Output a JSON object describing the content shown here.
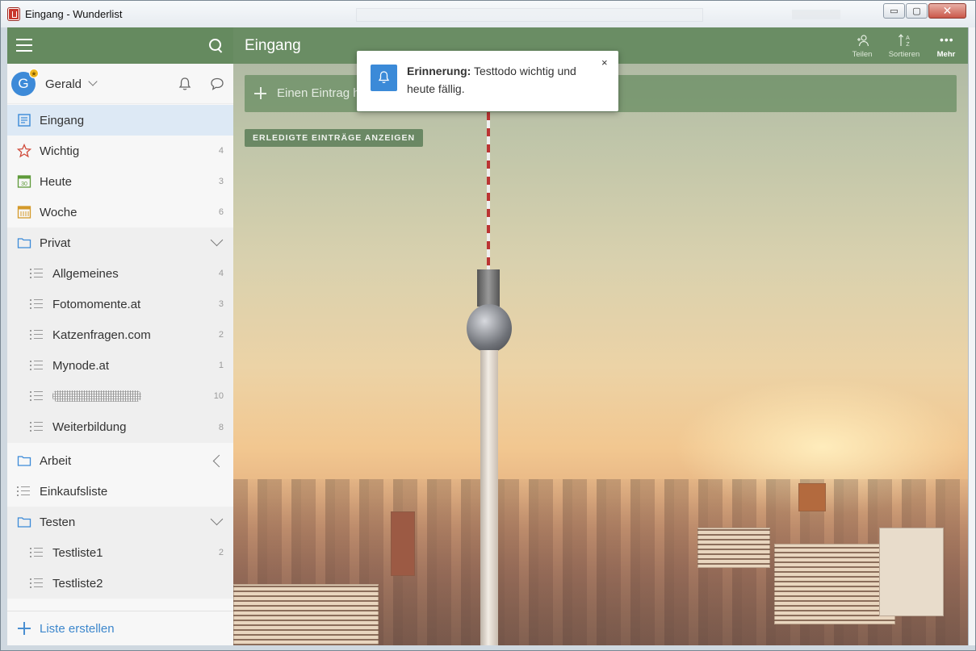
{
  "window": {
    "title": "Eingang - Wunderlist",
    "minimize": "▭",
    "maximize": "▢",
    "close": "✕"
  },
  "sidebar": {
    "user": {
      "initial": "G",
      "name": "Gerald"
    },
    "items": [
      {
        "label": "Eingang",
        "count": ""
      },
      {
        "label": "Wichtig",
        "count": "4"
      },
      {
        "label": "Heute",
        "count": "3"
      },
      {
        "label": "Woche",
        "count": "6"
      },
      {
        "label": "Privat",
        "count": ""
      },
      {
        "label": "Allgemeines",
        "count": "4"
      },
      {
        "label": "Fotomomente.at",
        "count": "3"
      },
      {
        "label": "Katzenfragen.com",
        "count": "2"
      },
      {
        "label": "Mynode.at",
        "count": "1"
      },
      {
        "label": "",
        "count": "10"
      },
      {
        "label": "Weiterbildung",
        "count": "8"
      },
      {
        "label": "Arbeit",
        "count": ""
      },
      {
        "label": "Einkaufsliste",
        "count": ""
      },
      {
        "label": "Testen",
        "count": ""
      },
      {
        "label": "Testliste1",
        "count": "2"
      },
      {
        "label": "Testliste2",
        "count": ""
      }
    ],
    "footer_label": "Liste erstellen"
  },
  "main": {
    "title": "Eingang",
    "actions": {
      "share": "Teilen",
      "sort": "Sortieren",
      "more": "Mehr"
    },
    "add_placeholder": "Einen Eintrag hinzufügen…",
    "completed_button": "ERLEDIGTE EINTRÄGE ANZEIGEN"
  },
  "notification": {
    "title": "Erinnerung:",
    "text": " Testtodo wichtig und heute fällig.",
    "close": "×"
  },
  "colors": {
    "header_green": "#658a5f",
    "accent_blue": "#3b8ad8",
    "active_bg": "#dde9f5"
  }
}
